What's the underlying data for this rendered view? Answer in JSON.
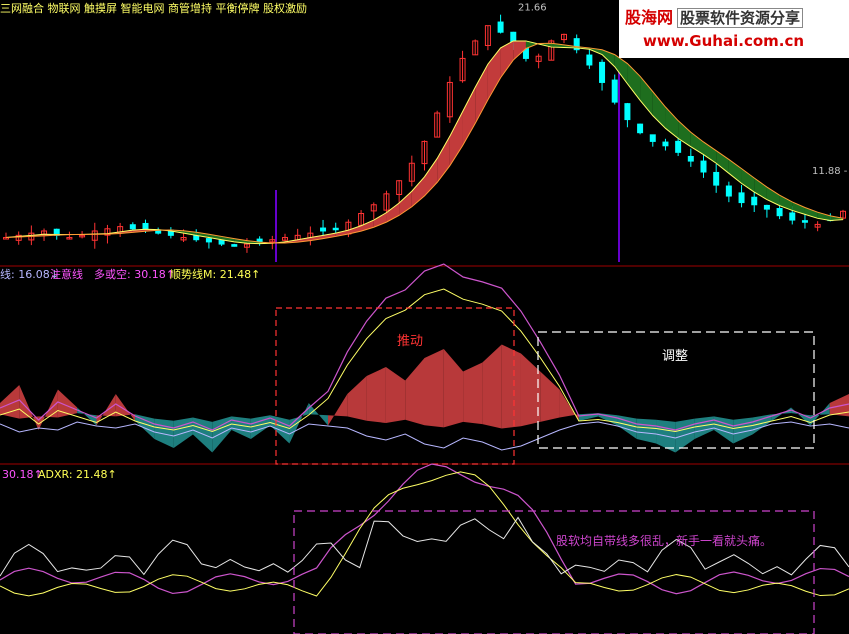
{
  "top_header_text": "三网融合  物联网  触摸屏  智能电网      商管增持  平衡停牌  股权激励",
  "price_labels": {
    "high": "21.66",
    "low_range": "11.88 - 1"
  },
  "panel2_legend": [
    {
      "text": "线: 16.08↓",
      "color": "#b7b7ff"
    },
    {
      "text": "注意线",
      "color": "#ff55ff"
    },
    {
      "text": "多或空: 30.18↑",
      "color": "#ff55ff"
    },
    {
      "text": "顺势线M: 21.48↑",
      "color": "#ffff55"
    }
  ],
  "panel3_legend": [
    {
      "text": "30.18↑",
      "color": "#ff55ff"
    },
    {
      "text": "ADXR: 21.48↑",
      "color": "#ffff55"
    }
  ],
  "annotations": {
    "push": "推动",
    "adjust": "调整",
    "note": "股软均自带线多很乱，新手一看就头痛。"
  },
  "watermark": {
    "site": "股海网",
    "slogan": "股票软件资源分享",
    "url": "www.Guhai.com.cn"
  },
  "colors": {
    "bull": "#ff3333",
    "bear": "#00ffff",
    "ribbon_red": "#c23b3b",
    "ribbon_green": "#1e6e1e",
    "osc_red": "#b8393a",
    "osc_teal": "#1e7f7f",
    "adx_pink": "#cc55cc",
    "adx_yellow": "#ffff66",
    "line_white": "#e6e6e6",
    "annotation_red": "#ff3333",
    "annotation_purple": "#cc44cc"
  },
  "chart_data": [
    {
      "type": "candlestick",
      "title": "",
      "price_close_series": [
        11.6,
        11.7,
        11.8,
        11.9,
        11.7,
        11.6,
        11.7,
        11.9,
        12.0,
        12.1,
        12.0,
        11.9,
        11.8,
        11.7,
        11.6,
        11.5,
        11.4,
        11.3,
        11.2,
        11.3,
        11.4,
        11.5,
        11.6,
        11.7,
        11.8,
        11.9,
        12.0,
        12.3,
        12.7,
        13.1,
        13.6,
        14.2,
        15.0,
        16.0,
        17.3,
        18.7,
        19.8,
        20.6,
        21.3,
        21.0,
        20.3,
        19.8,
        19.9,
        20.6,
        20.9,
        20.2,
        19.5,
        18.7,
        17.8,
        17.0,
        16.4,
        16.0,
        15.8,
        15.5,
        15.1,
        14.6,
        14.0,
        13.5,
        13.2,
        13.1,
        12.9,
        12.6,
        12.4,
        12.3,
        12.2,
        12.4,
        12.8
      ],
      "annotated_values": {
        "high": 21.66,
        "range_low": 11.88
      }
    },
    {
      "type": "area",
      "title": "",
      "series": [
        {
          "name": "多或空",
          "values": [
            2,
            6,
            -4,
            5,
            1,
            -3,
            4,
            -2,
            -6,
            -8,
            -5,
            -9,
            -4,
            -6,
            -3,
            -7,
            2,
            -3,
            4,
            8,
            10,
            7,
            12,
            14,
            9,
            11,
            15,
            13,
            9,
            5,
            -2,
            -1,
            -3,
            -6,
            -7,
            -9,
            -6,
            -4,
            -7,
            -5,
            -2,
            1,
            -3,
            2,
            4
          ]
        }
      ],
      "push_phase": "推动",
      "adjust_phase": "调整"
    },
    {
      "type": "line",
      "title": "",
      "series": [
        {
          "name": "ADXR",
          "current": 21.48
        },
        {
          "current": 30.18
        }
      ]
    }
  ]
}
